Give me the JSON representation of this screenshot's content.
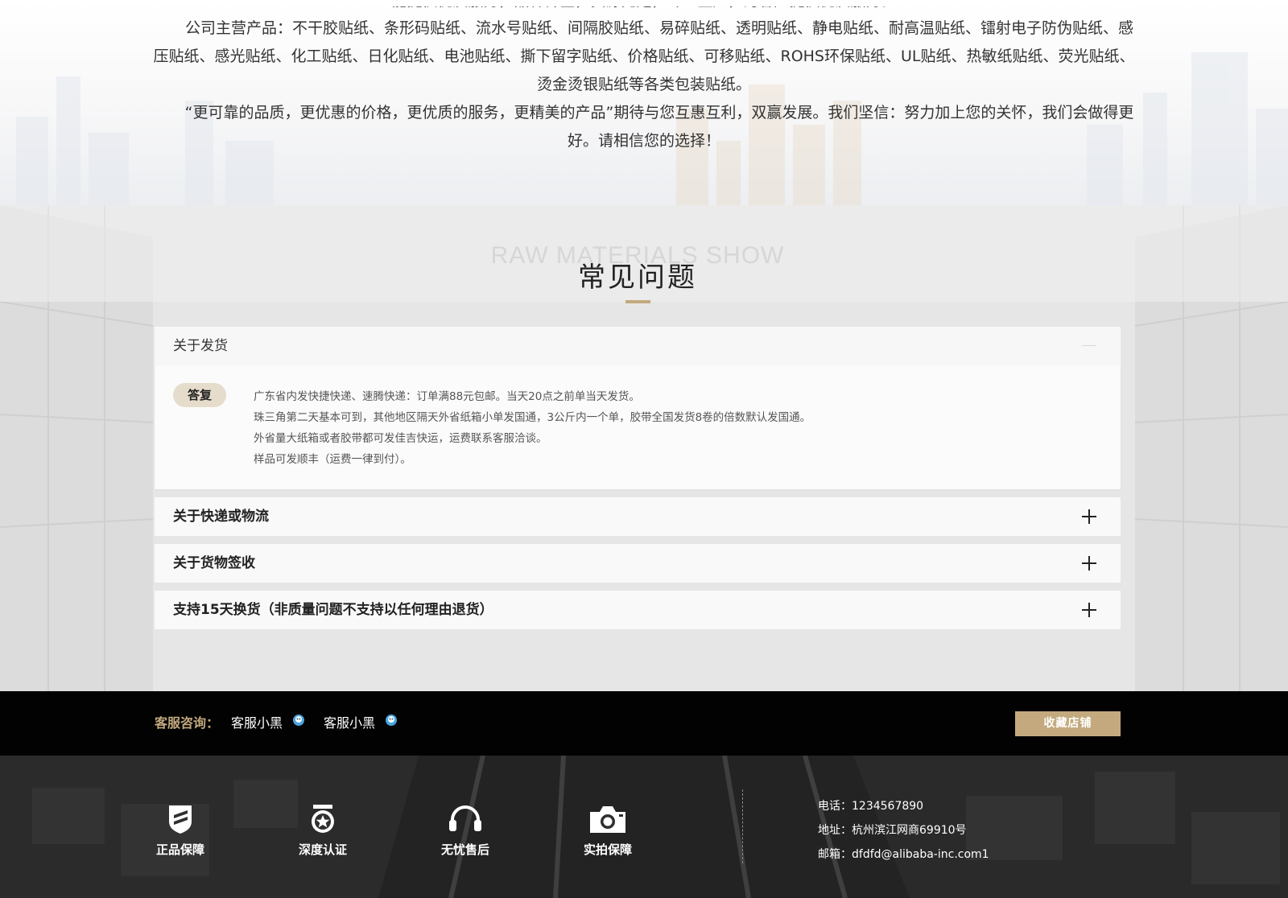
{
  "intro": {
    "line_partial": "能提供优质服务，品种齐全，货源充足，专业生产，为客户提供优质服务。",
    "paragraph_products": "公司主营产品：不干胶贴纸、条形码贴纸、流水号贴纸、间隔胶贴纸、易碎贴纸、透明贴纸、静电贴纸、耐高温贴纸、镭射电子防伪贴纸、感压贴纸、感光贴纸、化工贴纸、日化贴纸、电池贴纸、撕下留字贴纸、价格贴纸、可移贴纸、ROHS环保贴纸、UL贴纸、热敏纸贴纸、荧光贴纸、烫金烫银贴纸等各类包装贴纸。",
    "paragraph_slogan": "“更可靠的品质，更优惠的价格，更优质的服务，更精美的产品”期待与您互惠互利，双赢发展。我们坚信：努力加上您的关怀，我们会做得更好。请相信您的选择！"
  },
  "faq": {
    "ghost_title": "RAW MATERIALS SHOW",
    "title": "常见问题",
    "answer_badge": "答复",
    "items": [
      {
        "question": "关于发货",
        "open": true,
        "answer": [
          "广东省内发快捷快递、速腾快递：订单满88元包邮。当天20点之前单当天发货。",
          "珠三角第二天基本可到，其他地区隔天外省纸箱小单发国通，3公斤内一个单，胶带全国发货8卷的倍数默认发国通。",
          "外省量大纸箱或者胶带都可发佳吉快运，运费联系客服洽谈。",
          "样品可发顺丰（运费一律到付）。"
        ]
      },
      {
        "question": "关于快递或物流",
        "open": false
      },
      {
        "question": "关于货物签收",
        "open": false
      },
      {
        "question": "支持15天换货（非质量问题不支持以任何理由退货）",
        "open": false
      }
    ]
  },
  "contact": {
    "label": "客服咨询：",
    "agents": [
      "客服小黑",
      "客服小黑"
    ],
    "favorite_button": "收藏店铺"
  },
  "footer": {
    "badges": [
      {
        "label": "正品保障",
        "icon": "shield-icon"
      },
      {
        "label": "深度认证",
        "icon": "medal-icon"
      },
      {
        "label": "无忧售后",
        "icon": "headset-icon"
      },
      {
        "label": "实拍保障",
        "icon": "camera-icon"
      }
    ],
    "phone": "电话：1234567890",
    "address": "地址：杭州滨江网商69910号",
    "email": "邮箱：dfdfd@alibaba-inc.com1"
  },
  "colors": {
    "accent": "#c3a97d",
    "answer_badge_bg": "#e6dccb",
    "contact_bar_bg": "#020202",
    "footer_bg": "#2a2a2a"
  }
}
